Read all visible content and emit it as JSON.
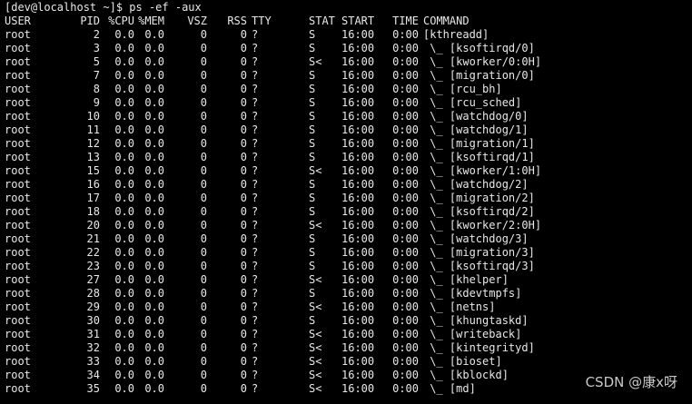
{
  "terminal": {
    "prompt": "[dev@localhost ~]$ ps -ef -aux",
    "headers": {
      "user": "USER",
      "pid": "PID",
      "cpu": "%CPU",
      "mem": "%MEM",
      "vsz": "VSZ",
      "rss": "RSS",
      "tty": "TTY",
      "stat": "STAT",
      "start": "START",
      "time": "TIME",
      "command": "COMMAND"
    },
    "rows": [
      {
        "user": "root",
        "pid": "2",
        "cpu": "0.0",
        "mem": "0.0",
        "vsz": "0",
        "rss": "0",
        "tty": "?",
        "stat": "S",
        "start": "16:00",
        "time": "0:00",
        "command": "[kthreadd]"
      },
      {
        "user": "root",
        "pid": "3",
        "cpu": "0.0",
        "mem": "0.0",
        "vsz": "0",
        "rss": "0",
        "tty": "?",
        "stat": "S",
        "start": "16:00",
        "time": "0:00",
        "command": " \\_ [ksoftirqd/0]"
      },
      {
        "user": "root",
        "pid": "5",
        "cpu": "0.0",
        "mem": "0.0",
        "vsz": "0",
        "rss": "0",
        "tty": "?",
        "stat": "S<",
        "start": "16:00",
        "time": "0:00",
        "command": " \\_ [kworker/0:0H]"
      },
      {
        "user": "root",
        "pid": "7",
        "cpu": "0.0",
        "mem": "0.0",
        "vsz": "0",
        "rss": "0",
        "tty": "?",
        "stat": "S",
        "start": "16:00",
        "time": "0:00",
        "command": " \\_ [migration/0]"
      },
      {
        "user": "root",
        "pid": "8",
        "cpu": "0.0",
        "mem": "0.0",
        "vsz": "0",
        "rss": "0",
        "tty": "?",
        "stat": "S",
        "start": "16:00",
        "time": "0:00",
        "command": " \\_ [rcu_bh]"
      },
      {
        "user": "root",
        "pid": "9",
        "cpu": "0.0",
        "mem": "0.0",
        "vsz": "0",
        "rss": "0",
        "tty": "?",
        "stat": "S",
        "start": "16:00",
        "time": "0:00",
        "command": " \\_ [rcu_sched]"
      },
      {
        "user": "root",
        "pid": "10",
        "cpu": "0.0",
        "mem": "0.0",
        "vsz": "0",
        "rss": "0",
        "tty": "?",
        "stat": "S",
        "start": "16:00",
        "time": "0:00",
        "command": " \\_ [watchdog/0]"
      },
      {
        "user": "root",
        "pid": "11",
        "cpu": "0.0",
        "mem": "0.0",
        "vsz": "0",
        "rss": "0",
        "tty": "?",
        "stat": "S",
        "start": "16:00",
        "time": "0:00",
        "command": " \\_ [watchdog/1]"
      },
      {
        "user": "root",
        "pid": "12",
        "cpu": "0.0",
        "mem": "0.0",
        "vsz": "0",
        "rss": "0",
        "tty": "?",
        "stat": "S",
        "start": "16:00",
        "time": "0:00",
        "command": " \\_ [migration/1]"
      },
      {
        "user": "root",
        "pid": "13",
        "cpu": "0.0",
        "mem": "0.0",
        "vsz": "0",
        "rss": "0",
        "tty": "?",
        "stat": "S",
        "start": "16:00",
        "time": "0:00",
        "command": " \\_ [ksoftirqd/1]"
      },
      {
        "user": "root",
        "pid": "15",
        "cpu": "0.0",
        "mem": "0.0",
        "vsz": "0",
        "rss": "0",
        "tty": "?",
        "stat": "S<",
        "start": "16:00",
        "time": "0:00",
        "command": " \\_ [kworker/1:0H]"
      },
      {
        "user": "root",
        "pid": "16",
        "cpu": "0.0",
        "mem": "0.0",
        "vsz": "0",
        "rss": "0",
        "tty": "?",
        "stat": "S",
        "start": "16:00",
        "time": "0:00",
        "command": " \\_ [watchdog/2]"
      },
      {
        "user": "root",
        "pid": "17",
        "cpu": "0.0",
        "mem": "0.0",
        "vsz": "0",
        "rss": "0",
        "tty": "?",
        "stat": "S",
        "start": "16:00",
        "time": "0:00",
        "command": " \\_ [migration/2]"
      },
      {
        "user": "root",
        "pid": "18",
        "cpu": "0.0",
        "mem": "0.0",
        "vsz": "0",
        "rss": "0",
        "tty": "?",
        "stat": "S",
        "start": "16:00",
        "time": "0:00",
        "command": " \\_ [ksoftirqd/2]"
      },
      {
        "user": "root",
        "pid": "20",
        "cpu": "0.0",
        "mem": "0.0",
        "vsz": "0",
        "rss": "0",
        "tty": "?",
        "stat": "S<",
        "start": "16:00",
        "time": "0:00",
        "command": " \\_ [kworker/2:0H]"
      },
      {
        "user": "root",
        "pid": "21",
        "cpu": "0.0",
        "mem": "0.0",
        "vsz": "0",
        "rss": "0",
        "tty": "?",
        "stat": "S",
        "start": "16:00",
        "time": "0:00",
        "command": " \\_ [watchdog/3]"
      },
      {
        "user": "root",
        "pid": "22",
        "cpu": "0.0",
        "mem": "0.0",
        "vsz": "0",
        "rss": "0",
        "tty": "?",
        "stat": "S",
        "start": "16:00",
        "time": "0:00",
        "command": " \\_ [migration/3]"
      },
      {
        "user": "root",
        "pid": "23",
        "cpu": "0.0",
        "mem": "0.0",
        "vsz": "0",
        "rss": "0",
        "tty": "?",
        "stat": "S",
        "start": "16:00",
        "time": "0:00",
        "command": " \\_ [ksoftirqd/3]"
      },
      {
        "user": "root",
        "pid": "27",
        "cpu": "0.0",
        "mem": "0.0",
        "vsz": "0",
        "rss": "0",
        "tty": "?",
        "stat": "S<",
        "start": "16:00",
        "time": "0:00",
        "command": " \\_ [khelper]"
      },
      {
        "user": "root",
        "pid": "28",
        "cpu": "0.0",
        "mem": "0.0",
        "vsz": "0",
        "rss": "0",
        "tty": "?",
        "stat": "S",
        "start": "16:00",
        "time": "0:00",
        "command": " \\_ [kdevtmpfs]"
      },
      {
        "user": "root",
        "pid": "29",
        "cpu": "0.0",
        "mem": "0.0",
        "vsz": "0",
        "rss": "0",
        "tty": "?",
        "stat": "S<",
        "start": "16:00",
        "time": "0:00",
        "command": " \\_ [netns]"
      },
      {
        "user": "root",
        "pid": "30",
        "cpu": "0.0",
        "mem": "0.0",
        "vsz": "0",
        "rss": "0",
        "tty": "?",
        "stat": "S",
        "start": "16:00",
        "time": "0:00",
        "command": " \\_ [khungtaskd]"
      },
      {
        "user": "root",
        "pid": "31",
        "cpu": "0.0",
        "mem": "0.0",
        "vsz": "0",
        "rss": "0",
        "tty": "?",
        "stat": "S<",
        "start": "16:00",
        "time": "0:00",
        "command": " \\_ [writeback]"
      },
      {
        "user": "root",
        "pid": "32",
        "cpu": "0.0",
        "mem": "0.0",
        "vsz": "0",
        "rss": "0",
        "tty": "?",
        "stat": "S<",
        "start": "16:00",
        "time": "0:00",
        "command": " \\_ [kintegrityd]"
      },
      {
        "user": "root",
        "pid": "33",
        "cpu": "0.0",
        "mem": "0.0",
        "vsz": "0",
        "rss": "0",
        "tty": "?",
        "stat": "S<",
        "start": "16:00",
        "time": "0:00",
        "command": " \\_ [bioset]"
      },
      {
        "user": "root",
        "pid": "34",
        "cpu": "0.0",
        "mem": "0.0",
        "vsz": "0",
        "rss": "0",
        "tty": "?",
        "stat": "S<",
        "start": "16:00",
        "time": "0:00",
        "command": " \\_ [kblockd]"
      },
      {
        "user": "root",
        "pid": "35",
        "cpu": "0.0",
        "mem": "0.0",
        "vsz": "0",
        "rss": "0",
        "tty": "?",
        "stat": "S<",
        "start": "16:00",
        "time": "0:00",
        "command": " \\_ [md]"
      }
    ]
  },
  "watermark": "CSDN @康x呀",
  "colors": {
    "background": "#000000",
    "foreground": "#e8e8e8",
    "watermark": "#c8c8c8"
  }
}
